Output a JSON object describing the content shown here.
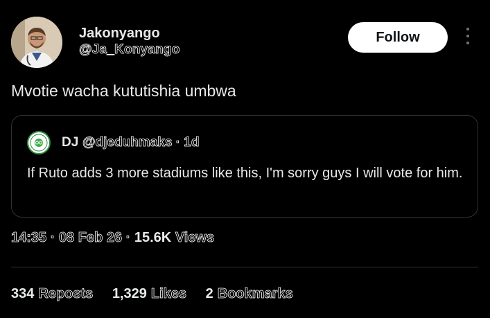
{
  "author": {
    "display_name": "Jakonyango",
    "handle": "@Ja_Konyango",
    "follow_label": "Follow"
  },
  "tweet": {
    "text": "Mvotie wacha kututishia umbwa",
    "timestamp": "14:35 · 08 Feb 26 ·",
    "views_count": "15.6K",
    "views_label": "Views"
  },
  "quote": {
    "display_name": "DJ",
    "handle_time": "@djeduhmaks · 1d",
    "text": "If Ruto adds 3 more stadiums like this, I'm sorry guys I will vote for him."
  },
  "stats": {
    "reposts_count": "334",
    "reposts_label": "Reposts",
    "likes_count": "1,329",
    "likes_label": "Likes",
    "bookmarks_count": "2",
    "bookmarks_label": "Bookmarks"
  },
  "colors": {
    "background": "#000000",
    "text": "#e7e9ea",
    "muted": "#71767b",
    "border": "#2f3336"
  }
}
